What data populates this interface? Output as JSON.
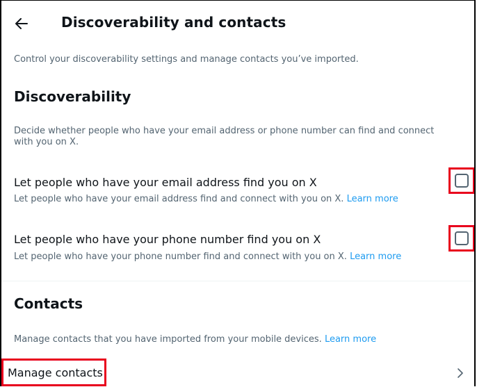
{
  "header": {
    "title": "Discoverability and contacts",
    "back_icon": "arrow-left-icon"
  },
  "subtitle": "Control your discoverability settings and manage contacts you’ve imported.",
  "discoverability": {
    "heading": "Discoverability",
    "description_line1": "Decide whether people who have your email address or phone number can find and connect",
    "description_line2": "with you on X.",
    "email_setting": {
      "title": "Let people who have your email address find you on X",
      "subtitle": "Let people who have your email address find and connect with you on X.",
      "link": "Learn more",
      "checked": false
    },
    "phone_setting": {
      "title": "Let people who have your phone number find you on X",
      "subtitle": "Let people who have your phone number find and connect with you on X.",
      "link": "Learn more",
      "checked": false
    }
  },
  "contacts": {
    "heading": "Contacts",
    "description": "Manage contacts that you have imported from your mobile devices.",
    "link": "Learn more",
    "manage_label": "Manage contacts",
    "chevron_icon": "chevron-right-icon"
  },
  "colors": {
    "text_primary": "#0f1419",
    "text_secondary": "#536471",
    "link": "#1d9bf0",
    "highlight": "#e8001c"
  }
}
